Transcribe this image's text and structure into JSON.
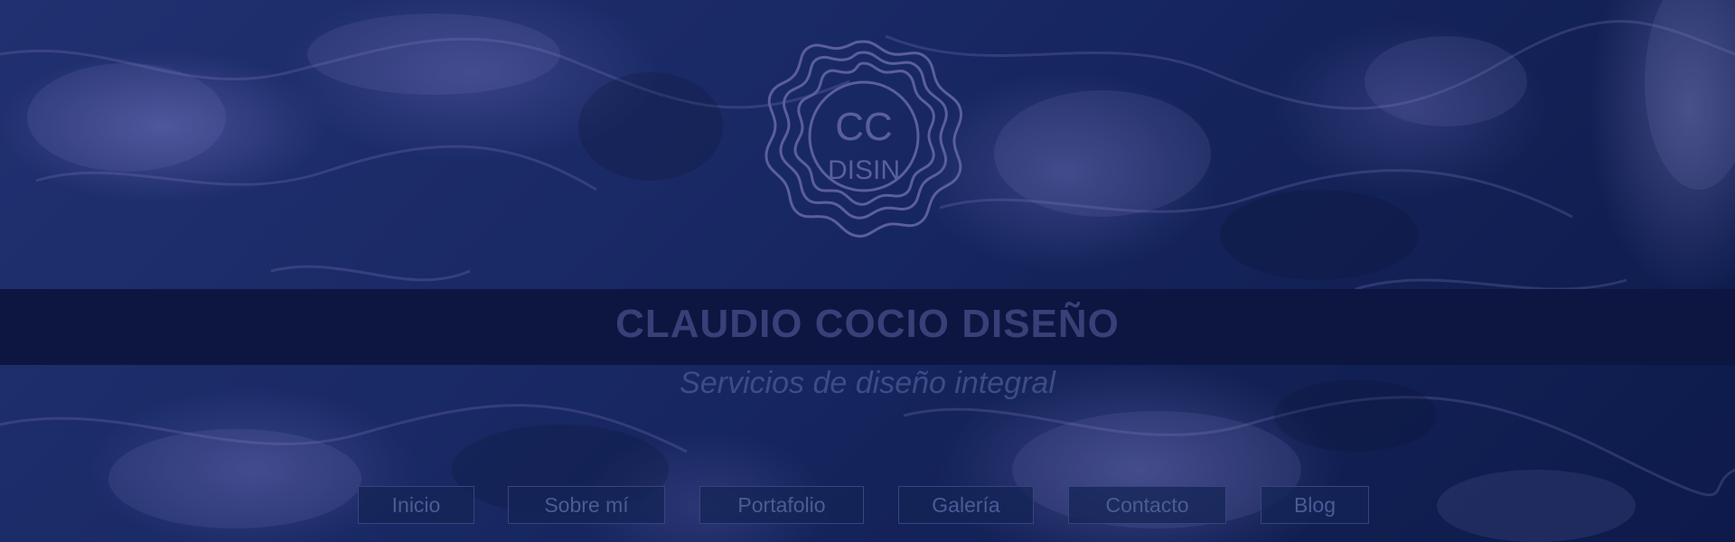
{
  "brand": {
    "logo_line1": "CC",
    "logo_line2": "DISIN",
    "title": "CLAUDIO COCIO DISEÑO",
    "tagline": "Servicios de diseño integral"
  },
  "nav": {
    "items": [
      {
        "label": "Inicio"
      },
      {
        "label": "Sobre mí"
      },
      {
        "label": "Portafolio"
      },
      {
        "label": "Galería"
      },
      {
        "label": "Contacto"
      },
      {
        "label": "Blog"
      }
    ]
  },
  "colors": {
    "background": "#1a2a66",
    "band": "#0c1640",
    "title_text": "#3a3f78",
    "nav_border": "#34467e"
  }
}
